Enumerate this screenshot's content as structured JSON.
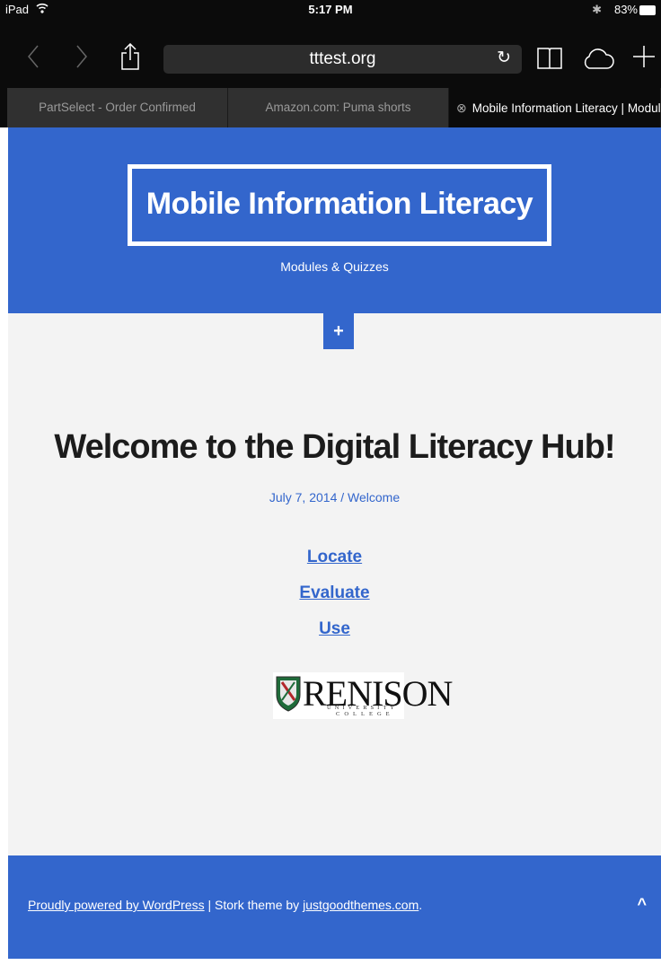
{
  "status_bar": {
    "device": "iPad",
    "time": "5:17 PM",
    "battery_percent": "83%"
  },
  "browser": {
    "url": "tttest.org",
    "tabs": [
      {
        "label": "PartSelect - Order Confirmed"
      },
      {
        "label": "Amazon.com: Puma shorts"
      },
      {
        "label": "Mobile Information Literacy | Modul..."
      }
    ]
  },
  "site": {
    "title": "Mobile Information Literacy",
    "tagline": "Modules & Quizzes",
    "toggle": "+"
  },
  "post": {
    "title": "Welcome to the Digital Literacy Hub!",
    "meta": "July 7, 2014 / Welcome",
    "links": [
      "Locate",
      "Evaluate",
      "Use"
    ]
  },
  "logo": {
    "word": "RENISON",
    "line1": "UNIVERSITY",
    "line2": "COLLEGE"
  },
  "footer": {
    "wordpress_link": "Proudly powered by WordPress",
    "separator_text": " | Stork theme by ",
    "theme_link": "justgoodthemes.com",
    "end_text": ".",
    "up_arrow": "^"
  },
  "colors": {
    "brand_blue": "#3366cc",
    "page_bg": "#f3f3f3",
    "chrome_bg": "#0b0b0b"
  },
  "icons": [
    "wifi-icon",
    "bluetooth-icon",
    "battery-icon",
    "back-icon",
    "forward-icon",
    "share-icon",
    "reload-icon",
    "bookmarks-icon",
    "cloud-icon",
    "new-tab-icon",
    "tab-close-icon",
    "shield-icon",
    "scroll-top-icon"
  ]
}
